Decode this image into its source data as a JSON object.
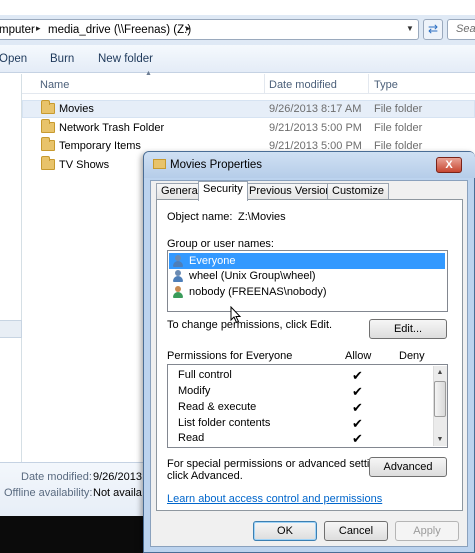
{
  "explorer": {
    "address": {
      "segments": [
        "mputer",
        "media_drive (\\\\Freenas) (Z:)"
      ],
      "search_placeholder": "Sea"
    },
    "toolbar": {
      "open": "Open",
      "burn": "Burn",
      "new_folder": "New folder"
    },
    "columns": {
      "name": "Name",
      "date_modified": "Date modified",
      "type": "Type"
    },
    "files": [
      {
        "name": "Movies",
        "date": "9/26/2013 8:17 AM",
        "type": "File folder",
        "selected": true
      },
      {
        "name": "Network Trash Folder",
        "date": "9/21/2013 5:00 PM",
        "type": "File folder",
        "selected": false
      },
      {
        "name": "Temporary Items",
        "date": "9/21/2013 5:00 PM",
        "type": "File folder",
        "selected": false
      },
      {
        "name": "TV Shows",
        "date": "9/21/2013 5:00 PM",
        "type": "File folder",
        "selected": false
      }
    ],
    "details": {
      "date_modified_label": "Date modified:",
      "date_modified_value": "9/26/2013",
      "offline_label": "Offline availability:",
      "offline_value": "Not availa"
    }
  },
  "dialog": {
    "title": "Movies Properties",
    "close_label": "X",
    "tabs": [
      "General",
      "Security",
      "Previous Versions",
      "Customize"
    ],
    "active_tab": "Security",
    "object_name_label": "Object name:",
    "object_name_value": "Z:\\Movies",
    "group_label": "Group or user names:",
    "users": [
      {
        "name": "Everyone",
        "selected": true
      },
      {
        "name": "wheel (Unix Group\\wheel)",
        "selected": false
      },
      {
        "name": "nobody (FREENAS\\nobody)",
        "selected": false
      }
    ],
    "change_text": "To change permissions, click Edit.",
    "edit_button": "Edit...",
    "permissions_label": "Permissions for Everyone",
    "allow_label": "Allow",
    "deny_label": "Deny",
    "permissions": [
      {
        "name": "Full control",
        "allow": true,
        "deny": false
      },
      {
        "name": "Modify",
        "allow": true,
        "deny": false
      },
      {
        "name": "Read & execute",
        "allow": true,
        "deny": false
      },
      {
        "name": "List folder contents",
        "allow": true,
        "deny": false
      },
      {
        "name": "Read",
        "allow": true,
        "deny": false
      }
    ],
    "special_text_line1": "For special permissions or advanced settings,",
    "special_text_line2": "click Advanced.",
    "advanced_button": "Advanced",
    "learn_link": "Learn about access control and permissions",
    "ok_button": "OK",
    "cancel_button": "Cancel",
    "apply_button": "Apply",
    "check_glyph": "✔"
  }
}
